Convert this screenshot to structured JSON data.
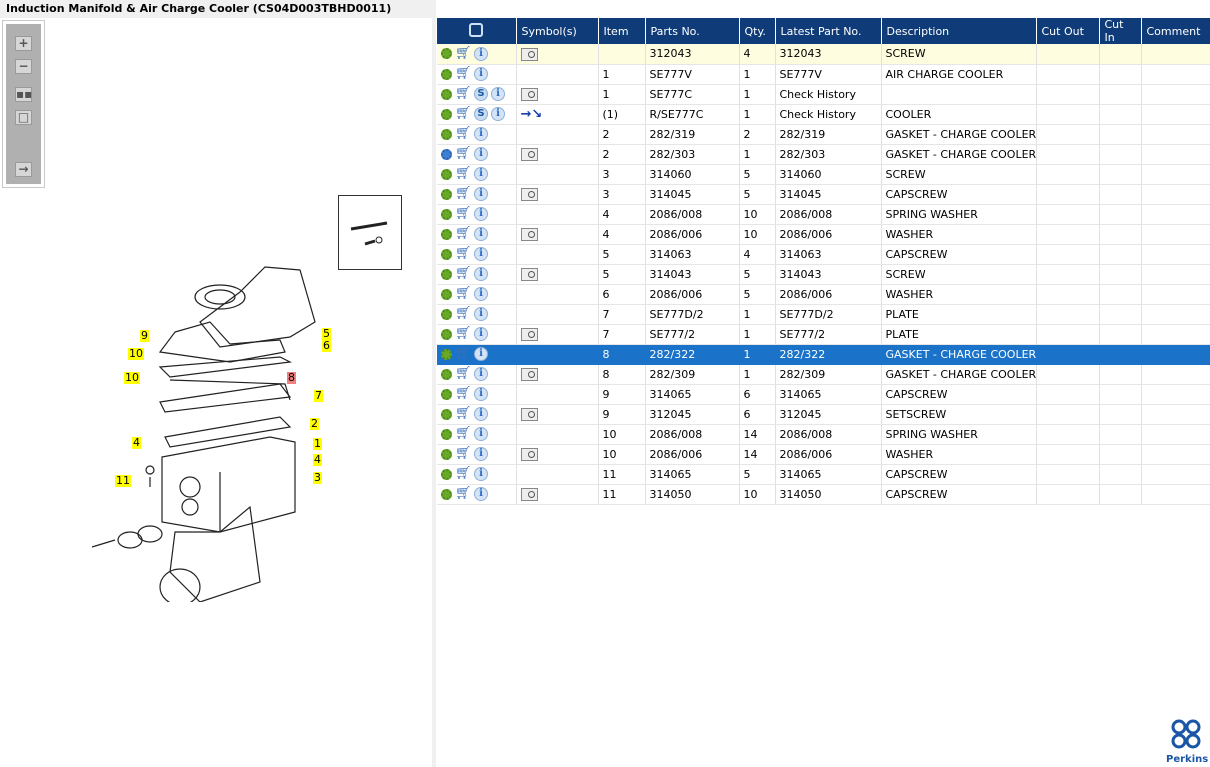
{
  "title": "Induction Manifold & Air Charge Cooler (CS04D003TBHD0011)",
  "toolbar": [
    "zoom-in",
    "zoom-out",
    "fit-all",
    "fit-window",
    "toggle-list"
  ],
  "diagram_labels": [
    {
      "text": "9",
      "cls": ""
    },
    {
      "text": "10",
      "cls": ""
    },
    {
      "text": "10",
      "cls": ""
    },
    {
      "text": "5",
      "cls": ""
    },
    {
      "text": "6",
      "cls": ""
    },
    {
      "text": "8",
      "cls": "red"
    },
    {
      "text": "7",
      "cls": ""
    },
    {
      "text": "2",
      "cls": ""
    },
    {
      "text": "1",
      "cls": ""
    },
    {
      "text": "4",
      "cls": ""
    },
    {
      "text": "4",
      "cls": ""
    },
    {
      "text": "3",
      "cls": ""
    },
    {
      "text": "11",
      "cls": ""
    }
  ],
  "table": {
    "headers": [
      "",
      "Symbol(s)",
      "Item",
      "Parts No.",
      "Qty.",
      "Latest Part No.",
      "Description",
      "Cut Out",
      "Cut In",
      "Comment"
    ],
    "rows": [
      {
        "gear": "green",
        "s": false,
        "sym": "book",
        "item": "",
        "part": "312043",
        "qty": "4",
        "latest": "312043",
        "desc": "SCREW"
      },
      {
        "gear": "green",
        "s": false,
        "sym": "",
        "item": "1",
        "part": "SE777V",
        "qty": "1",
        "latest": "SE777V",
        "desc": "AIR CHARGE COOLER"
      },
      {
        "gear": "green",
        "s": true,
        "sym": "book",
        "item": "1",
        "part": "SE777C",
        "qty": "1",
        "latest": "Check History",
        "desc": ""
      },
      {
        "gear": "green",
        "s": true,
        "sym": "arrow",
        "item": "(1)",
        "part": "R/SE777C",
        "qty": "1",
        "latest": "Check History",
        "desc": "COOLER"
      },
      {
        "gear": "green",
        "s": false,
        "sym": "",
        "item": "2",
        "part": "282/319",
        "qty": "2",
        "latest": "282/319",
        "desc": "GASKET - CHARGE COOLER"
      },
      {
        "gear": "blue",
        "s": false,
        "sym": "book",
        "item": "2",
        "part": "282/303",
        "qty": "1",
        "latest": "282/303",
        "desc": "GASKET - CHARGE COOLER"
      },
      {
        "gear": "green",
        "s": false,
        "sym": "",
        "item": "3",
        "part": "314060",
        "qty": "5",
        "latest": "314060",
        "desc": "SCREW"
      },
      {
        "gear": "green",
        "s": false,
        "sym": "book",
        "item": "3",
        "part": "314045",
        "qty": "5",
        "latest": "314045",
        "desc": "CAPSCREW"
      },
      {
        "gear": "green",
        "s": false,
        "sym": "",
        "item": "4",
        "part": "2086/008",
        "qty": "10",
        "latest": "2086/008",
        "desc": "SPRING WASHER"
      },
      {
        "gear": "green",
        "s": false,
        "sym": "book",
        "item": "4",
        "part": "2086/006",
        "qty": "10",
        "latest": "2086/006",
        "desc": "WASHER"
      },
      {
        "gear": "green",
        "s": false,
        "sym": "",
        "item": "5",
        "part": "314063",
        "qty": "4",
        "latest": "314063",
        "desc": "CAPSCREW"
      },
      {
        "gear": "green",
        "s": false,
        "sym": "book",
        "item": "5",
        "part": "314043",
        "qty": "5",
        "latest": "314043",
        "desc": "SCREW"
      },
      {
        "gear": "green",
        "s": false,
        "sym": "",
        "item": "6",
        "part": "2086/006",
        "qty": "5",
        "latest": "2086/006",
        "desc": "WASHER"
      },
      {
        "gear": "green",
        "s": false,
        "sym": "",
        "item": "7",
        "part": "SE777D/2",
        "qty": "1",
        "latest": "SE777D/2",
        "desc": "PLATE"
      },
      {
        "gear": "green",
        "s": false,
        "sym": "book",
        "item": "7",
        "part": "SE777/2",
        "qty": "1",
        "latest": "SE777/2",
        "desc": "PLATE"
      },
      {
        "gear": "green",
        "s": false,
        "sym": "",
        "item": "8",
        "part": "282/322",
        "qty": "1",
        "latest": "282/322",
        "desc": "GASKET - CHARGE COOLER",
        "selected": true
      },
      {
        "gear": "green",
        "s": false,
        "sym": "book",
        "item": "8",
        "part": "282/309",
        "qty": "1",
        "latest": "282/309",
        "desc": "GASKET - CHARGE COOLER"
      },
      {
        "gear": "green",
        "s": false,
        "sym": "",
        "item": "9",
        "part": "314065",
        "qty": "6",
        "latest": "314065",
        "desc": "CAPSCREW"
      },
      {
        "gear": "green",
        "s": false,
        "sym": "book",
        "item": "9",
        "part": "312045",
        "qty": "6",
        "latest": "312045",
        "desc": "SETSCREW"
      },
      {
        "gear": "green",
        "s": false,
        "sym": "",
        "item": "10",
        "part": "2086/008",
        "qty": "14",
        "latest": "2086/008",
        "desc": "SPRING WASHER"
      },
      {
        "gear": "green",
        "s": false,
        "sym": "book",
        "item": "10",
        "part": "2086/006",
        "qty": "14",
        "latest": "2086/006",
        "desc": "WASHER"
      },
      {
        "gear": "green",
        "s": false,
        "sym": "",
        "item": "11",
        "part": "314065",
        "qty": "5",
        "latest": "314065",
        "desc": "CAPSCREW"
      },
      {
        "gear": "green",
        "s": false,
        "sym": "book",
        "item": "11",
        "part": "314050",
        "qty": "10",
        "latest": "314050",
        "desc": "CAPSCREW"
      }
    ]
  },
  "logo": {
    "name": "Perkins"
  }
}
